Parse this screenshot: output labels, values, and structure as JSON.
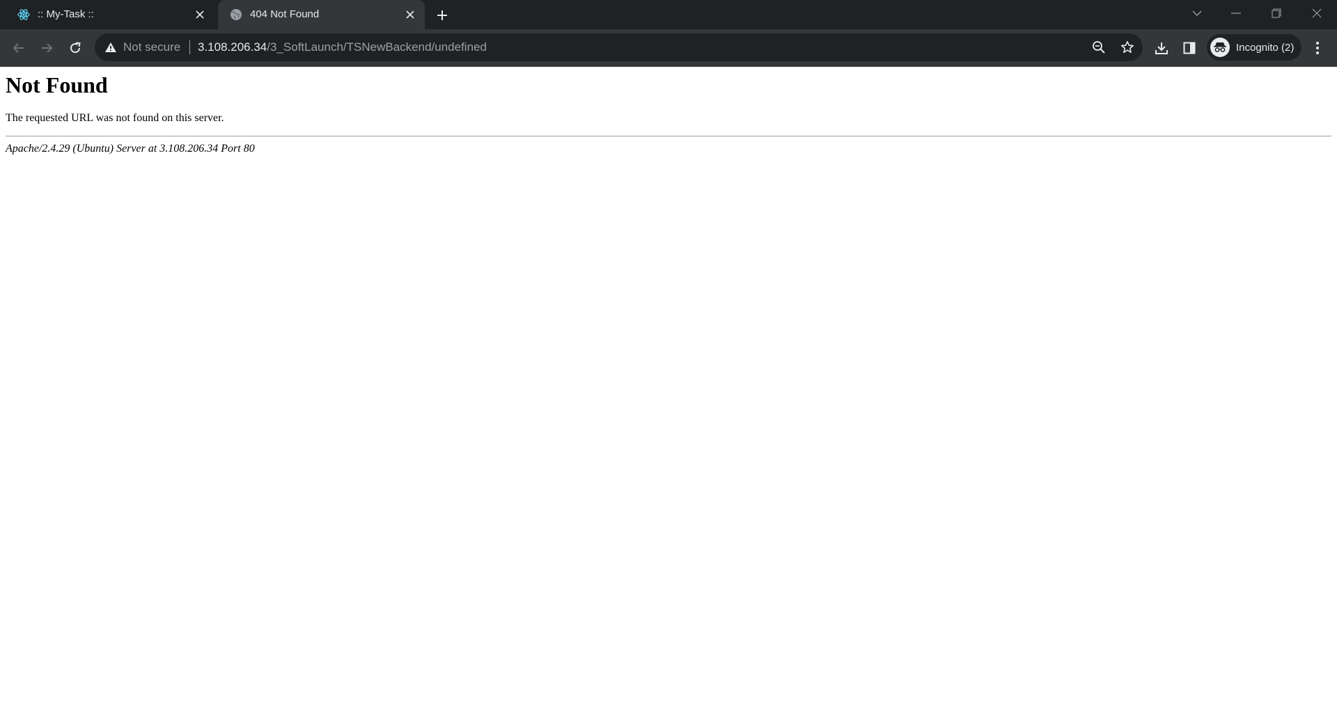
{
  "browser": {
    "tabs": [
      {
        "title": ":: My-Task ::",
        "active": false,
        "favicon": "react-icon"
      },
      {
        "title": "404 Not Found",
        "active": true,
        "favicon": "globe-icon"
      }
    ],
    "address_bar": {
      "security_label": "Not secure",
      "url_host": "3.108.206.34",
      "url_path": "/3_SoftLaunch/TSNewBackend/undefined"
    },
    "profile": {
      "label": "Incognito (2)"
    },
    "colors": {
      "tabstrip": "#202124",
      "toolbar": "#35363a",
      "omnibox": "#202124",
      "text": "#e8eaed",
      "muted": "#9aa0a6"
    }
  },
  "page": {
    "heading": "Not Found",
    "message": "The requested URL was not found on this server.",
    "server_signature": "Apache/2.4.29 (Ubuntu) Server at 3.108.206.34 Port 80"
  }
}
